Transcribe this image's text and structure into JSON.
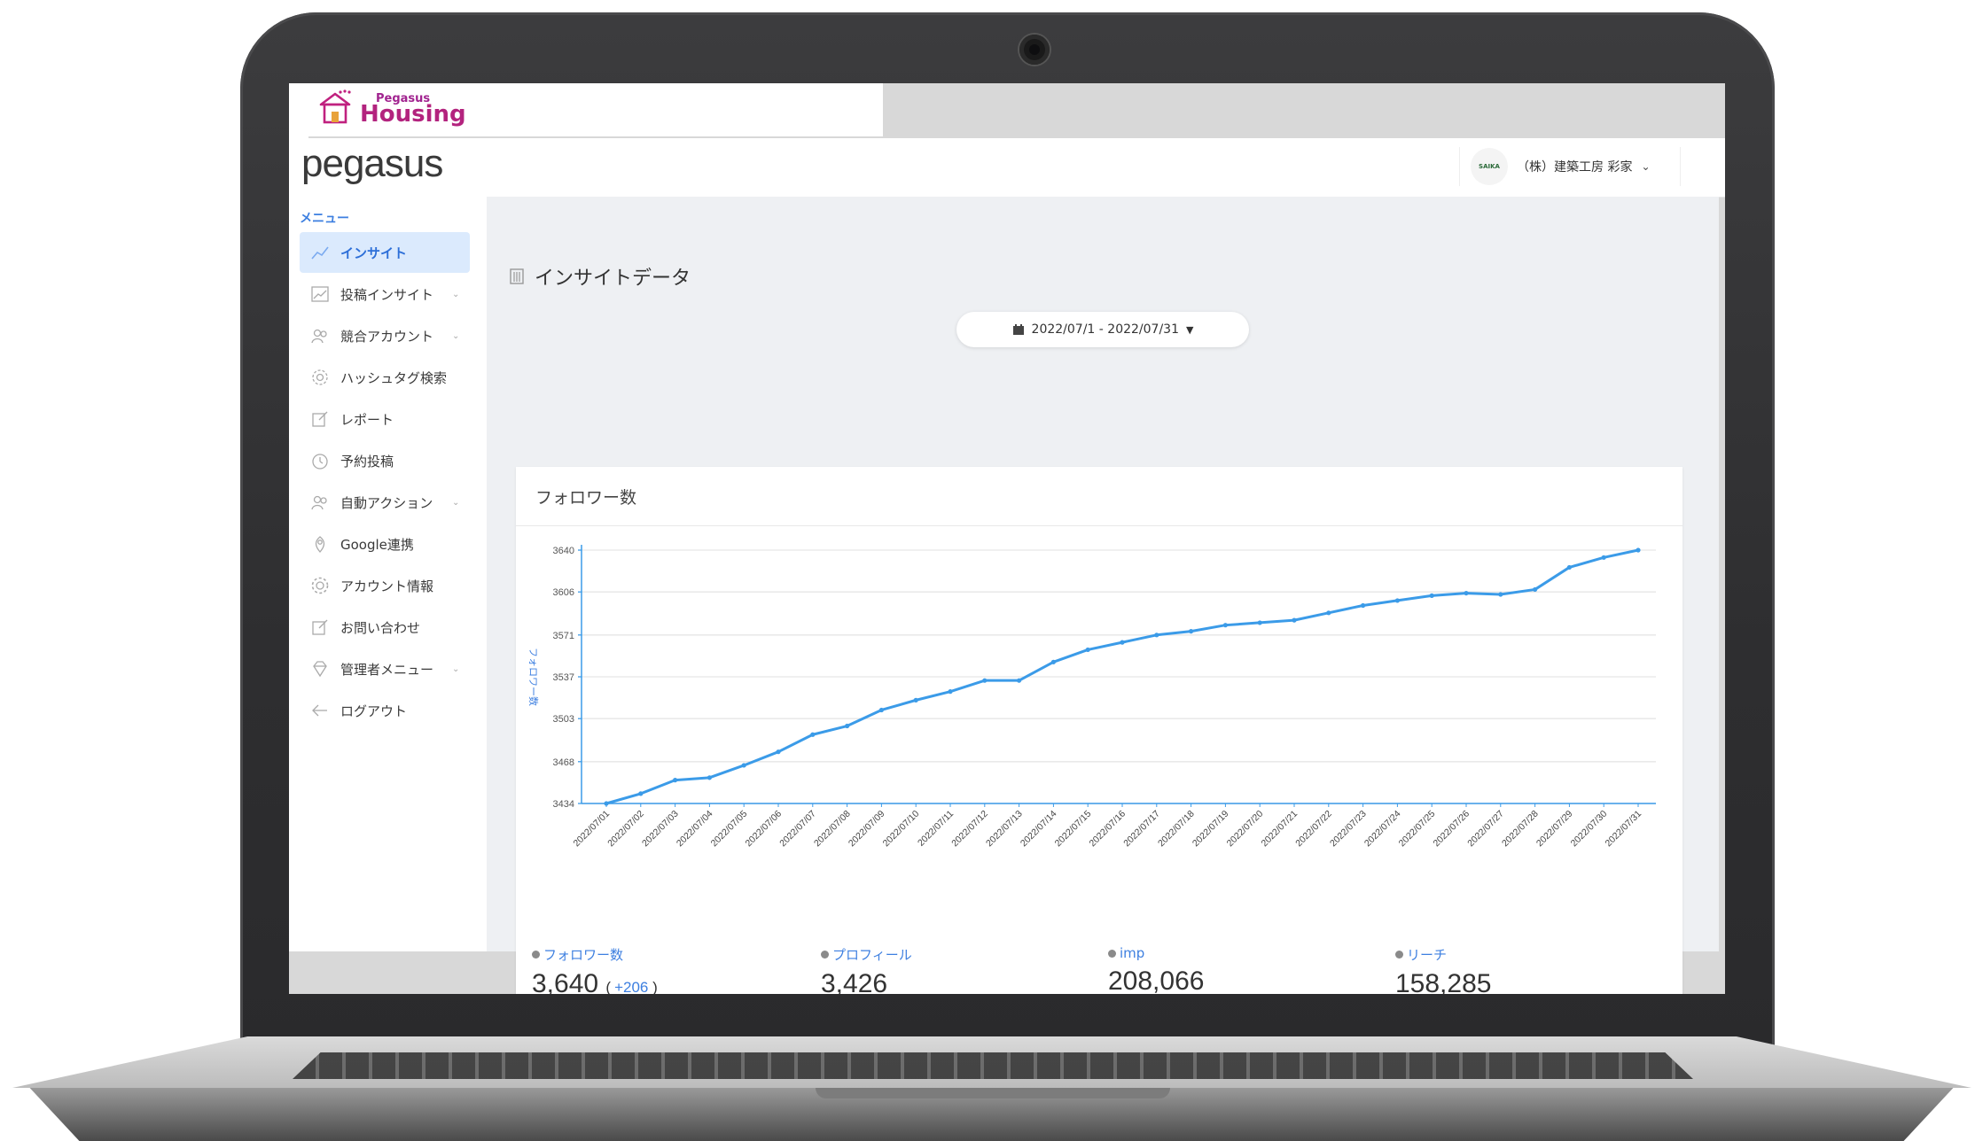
{
  "logo": {
    "small": "Pegasus",
    "big": "Housing"
  },
  "header": {
    "brand": "pegasus",
    "account": {
      "avatar_text": "SAIKA",
      "name": "（株）建築工房 彩家"
    }
  },
  "sidebar": {
    "caption": "メニュー",
    "items": [
      {
        "label": "インサイト",
        "icon": "line-chart-icon",
        "active": true,
        "chevron": false
      },
      {
        "label": "投稿インサイト",
        "icon": "chart-icon",
        "active": false,
        "chevron": true
      },
      {
        "label": "競合アカウント",
        "icon": "users-icon",
        "active": false,
        "chevron": true
      },
      {
        "label": "ハッシュタグ検索",
        "icon": "hashtag-icon",
        "active": false,
        "chevron": false
      },
      {
        "label": "レポート",
        "icon": "edit-icon",
        "active": false,
        "chevron": false
      },
      {
        "label": "予約投稿",
        "icon": "timer-icon",
        "active": false,
        "chevron": false
      },
      {
        "label": "自動アクション",
        "icon": "users-icon",
        "active": false,
        "chevron": true
      },
      {
        "label": "Google連携",
        "icon": "map-pin-icon",
        "active": false,
        "chevron": false
      },
      {
        "label": "アカウント情報",
        "icon": "gear-icon",
        "active": false,
        "chevron": false
      },
      {
        "label": "お問い合わせ",
        "icon": "edit-icon",
        "active": false,
        "chevron": false
      },
      {
        "label": "管理者メニュー",
        "icon": "diamond-icon",
        "active": false,
        "chevron": true
      },
      {
        "label": "ログアウト",
        "icon": "logout-icon",
        "active": false,
        "chevron": false
      }
    ]
  },
  "main": {
    "title": "インサイトデータ",
    "date_range": "2022/07/1 - 2022/07/31",
    "card_title": "フォロワー数"
  },
  "stats": [
    {
      "label": "フォロワー数",
      "value": "3,640",
      "delta": "+206"
    },
    {
      "label": "プロフィール",
      "value": "3,426"
    },
    {
      "label": "imp",
      "value": "208,066"
    },
    {
      "label": "リーチ",
      "value": "158,285"
    }
  ],
  "colors": {
    "accent": "#3d7fe0",
    "line": "#3b9be8",
    "active_bg": "#dbeafd"
  },
  "chart_data": {
    "type": "line",
    "ylabel": "フォロワー数",
    "yticks": [
      3434,
      3468,
      3503,
      3537,
      3571,
      3606,
      3640
    ],
    "ylim": [
      3434,
      3640
    ],
    "grid": true,
    "x": [
      "2022/07/01",
      "2022/07/02",
      "2022/07/03",
      "2022/07/04",
      "2022/07/05",
      "2022/07/06",
      "2022/07/07",
      "2022/07/08",
      "2022/07/09",
      "2022/07/10",
      "2022/07/11",
      "2022/07/12",
      "2022/07/13",
      "2022/07/14",
      "2022/07/15",
      "2022/07/16",
      "2022/07/17",
      "2022/07/18",
      "2022/07/19",
      "2022/07/20",
      "2022/07/21",
      "2022/07/22",
      "2022/07/23",
      "2022/07/24",
      "2022/07/25",
      "2022/07/26",
      "2022/07/27",
      "2022/07/28",
      "2022/07/29",
      "2022/07/30",
      "2022/07/31"
    ],
    "series": [
      {
        "values": [
          3434,
          3442,
          3453,
          3455,
          3465,
          3476,
          3490,
          3497,
          3510,
          3518,
          3525,
          3534,
          3534,
          3549,
          3559,
          3565,
          3571,
          3574,
          3579,
          3581,
          3583,
          3589,
          3595,
          3599,
          3603,
          3605,
          3604,
          3608,
          3626,
          3634,
          3640
        ]
      }
    ]
  }
}
